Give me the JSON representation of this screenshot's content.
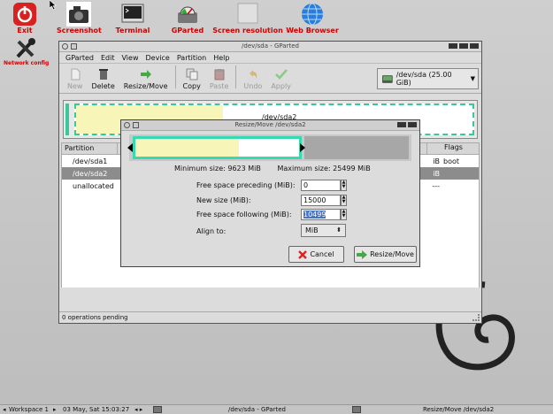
{
  "desktop": {
    "icons": [
      {
        "label": "Exit",
        "icon": "power-icon"
      },
      {
        "label": "Screenshot",
        "icon": "camera-icon"
      },
      {
        "label": "Terminal",
        "icon": "terminal-icon"
      },
      {
        "label": "GParted",
        "icon": "gparted-icon"
      },
      {
        "label": "Screen resolution",
        "icon": "monitor-icon"
      },
      {
        "label": "Web Browser",
        "icon": "globe-icon"
      },
      {
        "label": "Network config",
        "icon": "tools-icon"
      }
    ]
  },
  "gparted": {
    "title": "/dev/sda - GParted",
    "menu": [
      "GParted",
      "Edit",
      "View",
      "Device",
      "Partition",
      "Help"
    ],
    "toolbar": {
      "new": "New",
      "delete": "Delete",
      "resize_move": "Resize/Move",
      "copy": "Copy",
      "paste": "Paste",
      "undo": "Undo",
      "apply": "Apply"
    },
    "device": "/dev/sda  (25.00 GiB)",
    "partmap_label": "/dev/sda2",
    "table": {
      "col_partition": "Partition",
      "col_flags": "Flags",
      "rows": [
        {
          "name": "/dev/sda1",
          "size_tail": "iB",
          "flags": "boot"
        },
        {
          "name": "/dev/sda2",
          "size_tail": "iB",
          "flags": ""
        },
        {
          "name": "unallocated",
          "size_tail": "---",
          "flags": ""
        }
      ]
    },
    "status": "0 operations pending"
  },
  "dialog": {
    "title": "Resize/Move /dev/sda2",
    "min_size": "Minimum size: 9623 MiB",
    "max_size": "Maximum size: 25499 MiB",
    "labels": {
      "preceding": "Free space preceding (MiB):",
      "new_size": "New size (MiB):",
      "following": "Free space following (MiB):",
      "align": "Align to:"
    },
    "values": {
      "preceding": "0",
      "new_size": "15000",
      "following": "10499",
      "align": "MiB"
    },
    "buttons": {
      "cancel": "Cancel",
      "resize_move": "Resize/Move"
    }
  },
  "taskbar": {
    "workspace": "Workspace 1",
    "date": "03 May, Sat 15:03:27",
    "task1": "/dev/sda - GParted",
    "task2": "Resize/Move /dev/sda2"
  },
  "colors": {
    "accent": "#38d8b0",
    "used": "#f8f5b8",
    "label_red": "#d10000"
  }
}
